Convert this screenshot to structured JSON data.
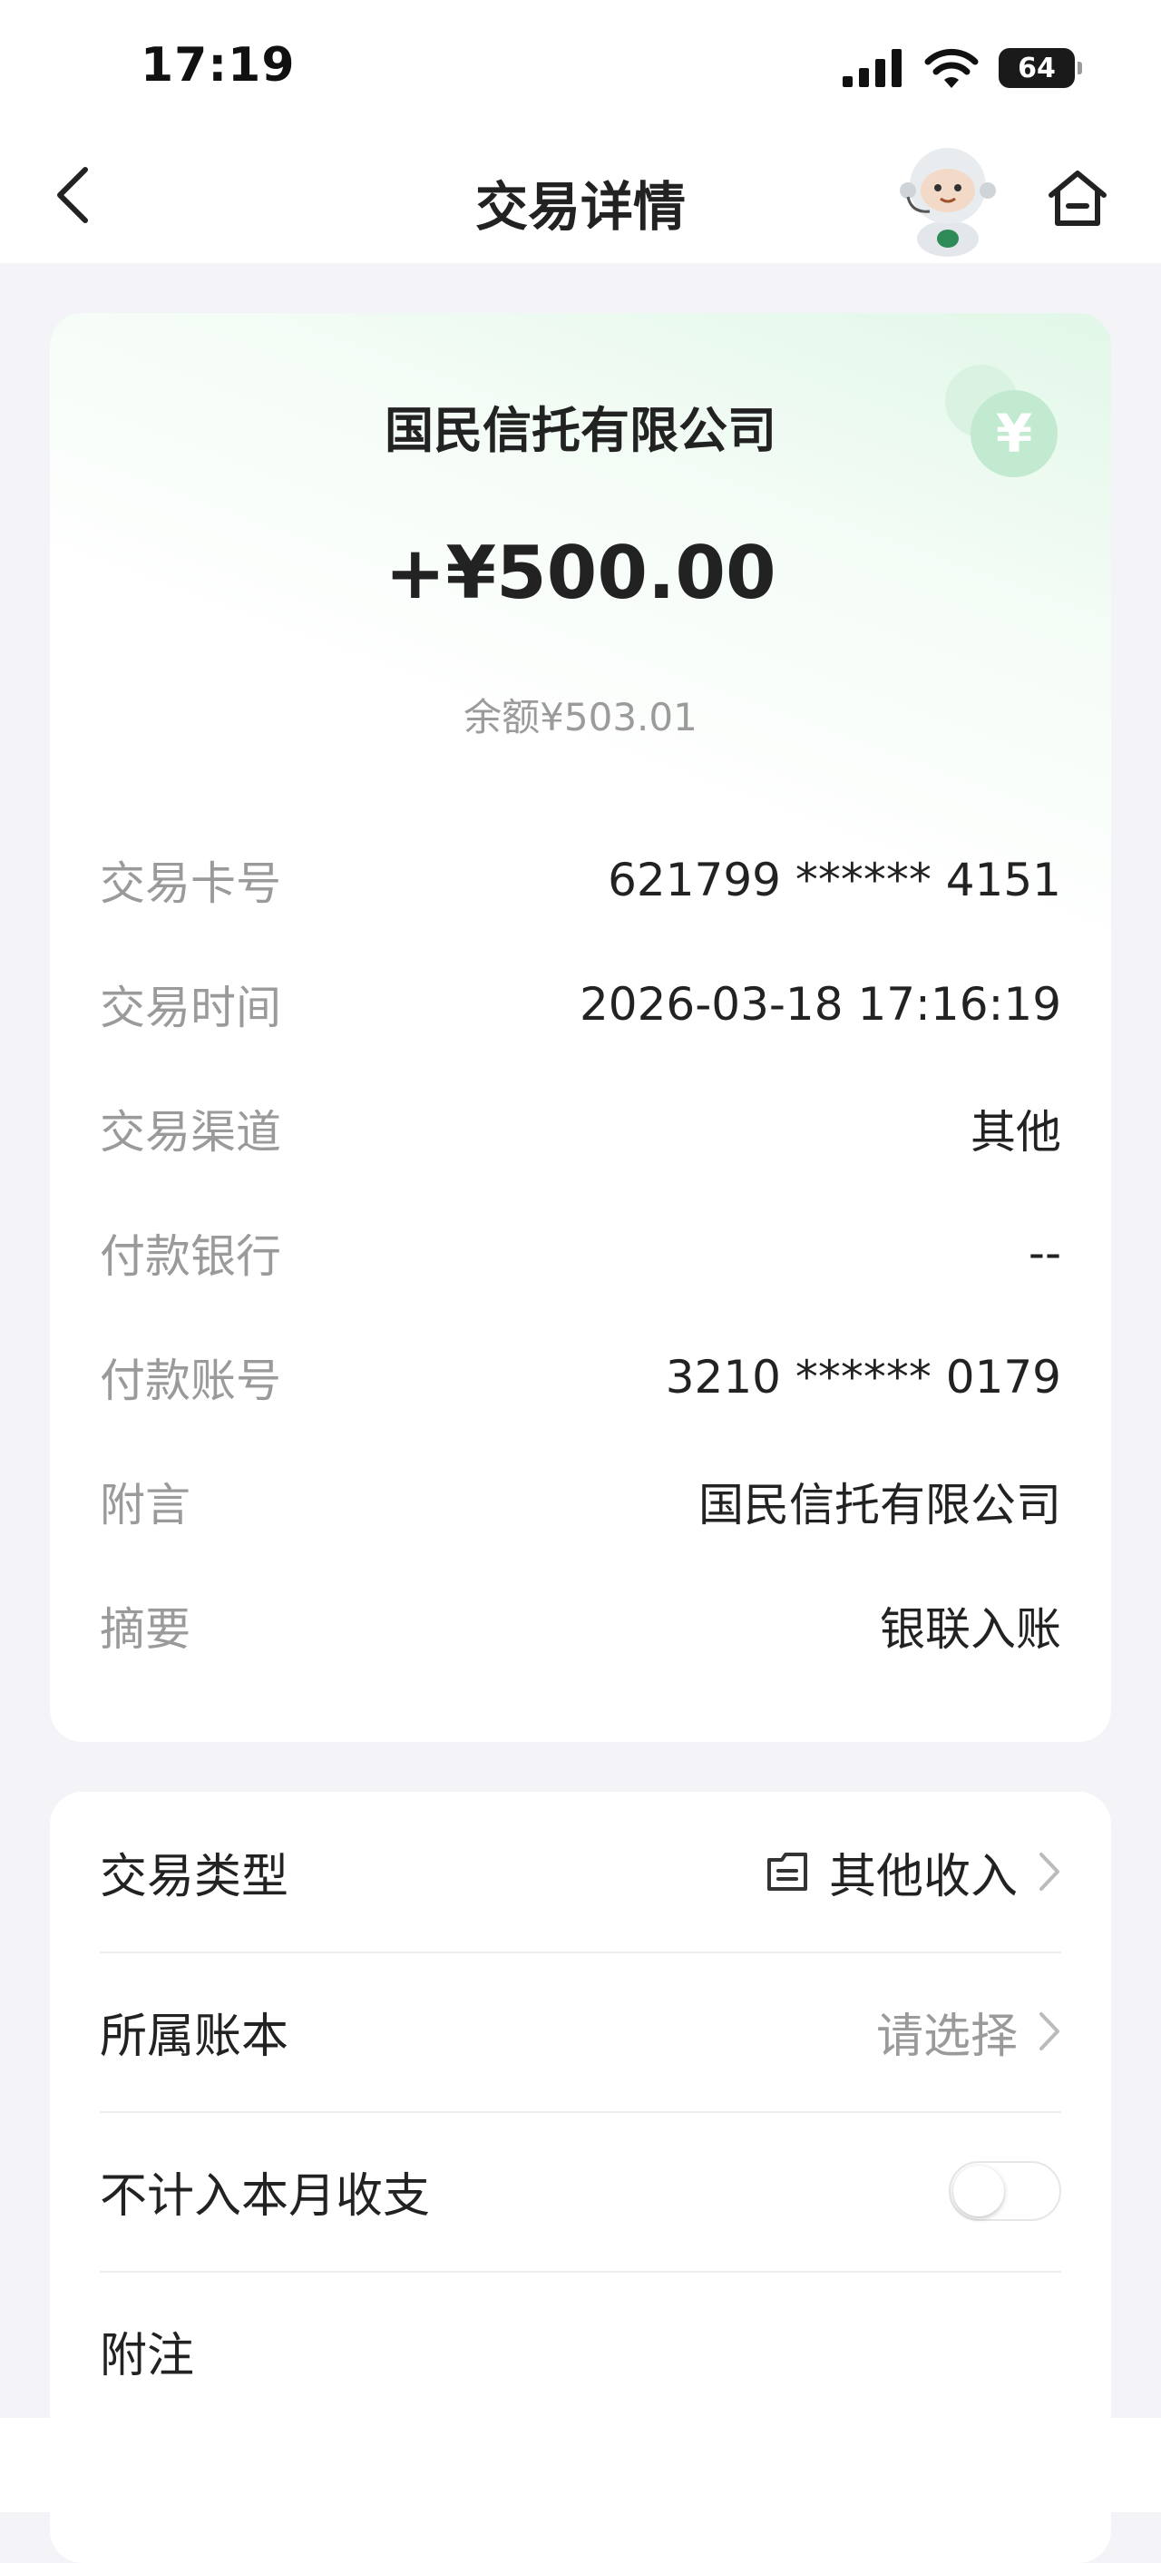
{
  "status_bar": {
    "time": "17:19",
    "battery": "64"
  },
  "nav": {
    "title": "交易详情"
  },
  "transaction": {
    "merchant": "国民信托有限公司",
    "amount": "+¥500.00",
    "balance": "余额¥503.01",
    "details": [
      {
        "label": "交易卡号",
        "value": "621799 ****** 4151"
      },
      {
        "label": "交易时间",
        "value": "2026-03-18 17:16:19"
      },
      {
        "label": "交易渠道",
        "value": "其他"
      },
      {
        "label": "付款银行",
        "value": "--"
      },
      {
        "label": "付款账号",
        "value": "3210 ****** 0179"
      },
      {
        "label": "附言",
        "value": "国民信托有限公司"
      },
      {
        "label": "摘要",
        "value": "银联入账"
      }
    ]
  },
  "settings": {
    "type": {
      "label": "交易类型",
      "value": "其他收入"
    },
    "ledger": {
      "label": "所属账本",
      "value": "请选择"
    },
    "exclude": {
      "label": "不计入本月收支",
      "enabled": false
    },
    "note": {
      "label": "附注"
    }
  },
  "colors": {
    "accent_green": "#5cc48a",
    "text_primary": "#222222",
    "text_secondary": "#9a9a9a",
    "background": "#f4f4f8"
  },
  "icons": [
    "signal-icon",
    "wifi-icon",
    "battery-icon",
    "back-arrow-icon",
    "robot-assistant-icon",
    "home-icon",
    "yuan-coin-icon",
    "category-icon",
    "chevron-right-icon"
  ]
}
